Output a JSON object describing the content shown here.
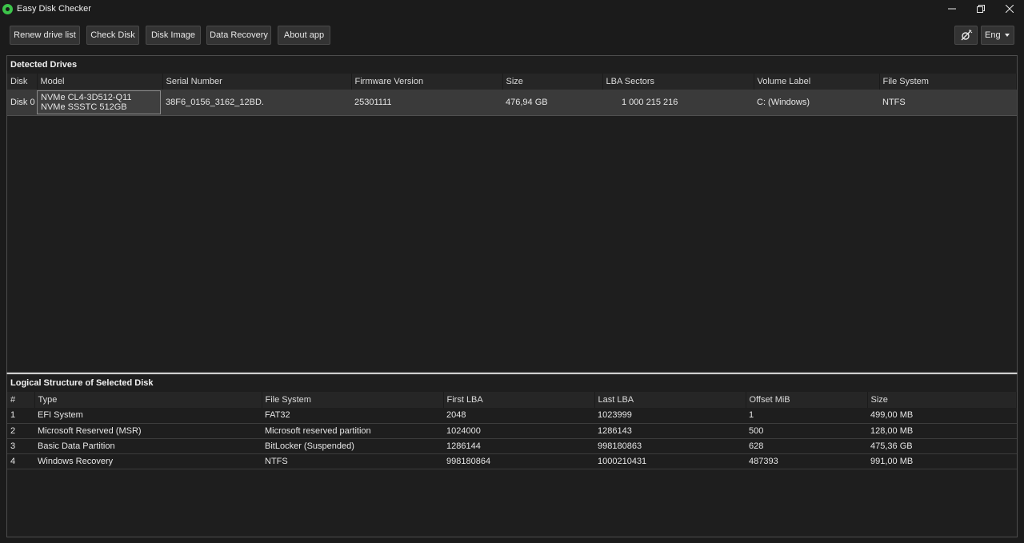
{
  "window": {
    "title": "Easy Disk Checker",
    "controls": {
      "minimize": "—",
      "restore": "❐",
      "close": "✕"
    }
  },
  "toolbar": {
    "buttons": [
      "Renew drive list",
      "Check Disk",
      "Disk Image",
      "Data Recovery",
      "About app"
    ],
    "theme_icon": "theme-toggle-icon",
    "language": "Eng"
  },
  "drives": {
    "title": "Detected Drives",
    "columns": [
      "Disk",
      "Model",
      "Serial Number",
      "Firmware Version",
      "Size",
      "LBA Sectors",
      "Volume Label",
      "File System"
    ],
    "rows": [
      [
        "Disk 0",
        "NVMe CL4-3D512-Q11 NVMe SSSTC 512GB",
        "38F6_0156_3162_12BD.",
        "25301111",
        "476,94 GB",
        "1 000 215 216",
        "C: (Windows)",
        "NTFS"
      ]
    ]
  },
  "partitions": {
    "title": "Logical Structure of Selected Disk",
    "columns": [
      "#",
      "Type",
      "File System",
      "First LBA",
      "Last LBA",
      "Offset MiB",
      "Size"
    ],
    "rows": [
      [
        "1",
        "EFI System",
        "FAT32",
        "2048",
        "1023999",
        "1",
        "499,00 MB"
      ],
      [
        "2",
        "Microsoft Reserved (MSR)",
        "Microsoft reserved partition",
        "1024000",
        "1286143",
        "500",
        "128,00 MB"
      ],
      [
        "3",
        "Basic Data Partition",
        "BitLocker (Suspended)",
        "1286144",
        "998180863",
        "628",
        "475,36 GB"
      ],
      [
        "4",
        "Windows Recovery",
        "NTFS",
        "998180864",
        "1000210431",
        "487393",
        "991,00 MB"
      ]
    ]
  },
  "colors": {
    "background": "#1b1b1b",
    "app_icon": "#3cc44a",
    "selected_row": "#3a3a3a"
  }
}
